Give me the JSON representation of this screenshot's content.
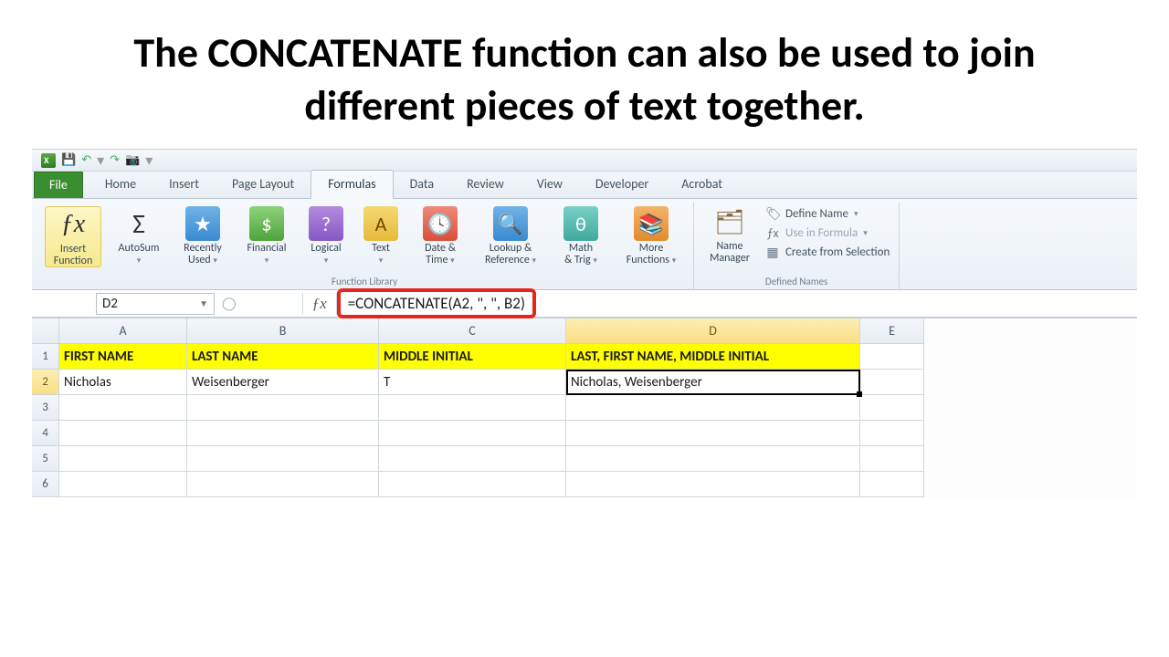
{
  "headline": "The CONCATENATE function can also be used to join different pieces of text together.",
  "ribbon": {
    "file": "File",
    "tabs": [
      "Home",
      "Insert",
      "Page Layout",
      "Formulas",
      "Data",
      "Review",
      "View",
      "Developer",
      "Acrobat"
    ],
    "active_tab": "Formulas",
    "insert_function": "Insert\nFunction",
    "items": {
      "autosum": "AutoSum",
      "recently": "Recently\nUsed",
      "financial": "Financial",
      "logical": "Logical",
      "text": "Text",
      "datetime": "Date &\nTime",
      "lookup": "Lookup &\nReference",
      "math": "Math\n& Trig",
      "more": "More\nFunctions"
    },
    "group_library": "Function Library",
    "name_manager": "Name\nManager",
    "defined": {
      "define": "Define Name",
      "use": "Use in Formula",
      "create": "Create from Selection"
    },
    "group_defined": "Defined Names"
  },
  "namebox": "D2",
  "formula": "=CONCATENATE(A2, \", \", B2)",
  "columns": [
    "A",
    "B",
    "C",
    "D",
    "E"
  ],
  "rows": [
    "1",
    "2",
    "3",
    "4",
    "5",
    "6"
  ],
  "headers": {
    "a": "FIRST NAME",
    "b": "LAST NAME",
    "c": "MIDDLE INITIAL",
    "d": "LAST, FIRST NAME, MIDDLE INITIAL"
  },
  "row2": {
    "a": "Nicholas",
    "b": "Weisenberger",
    "c": "T",
    "d": "Nicholas, Weisenberger"
  }
}
